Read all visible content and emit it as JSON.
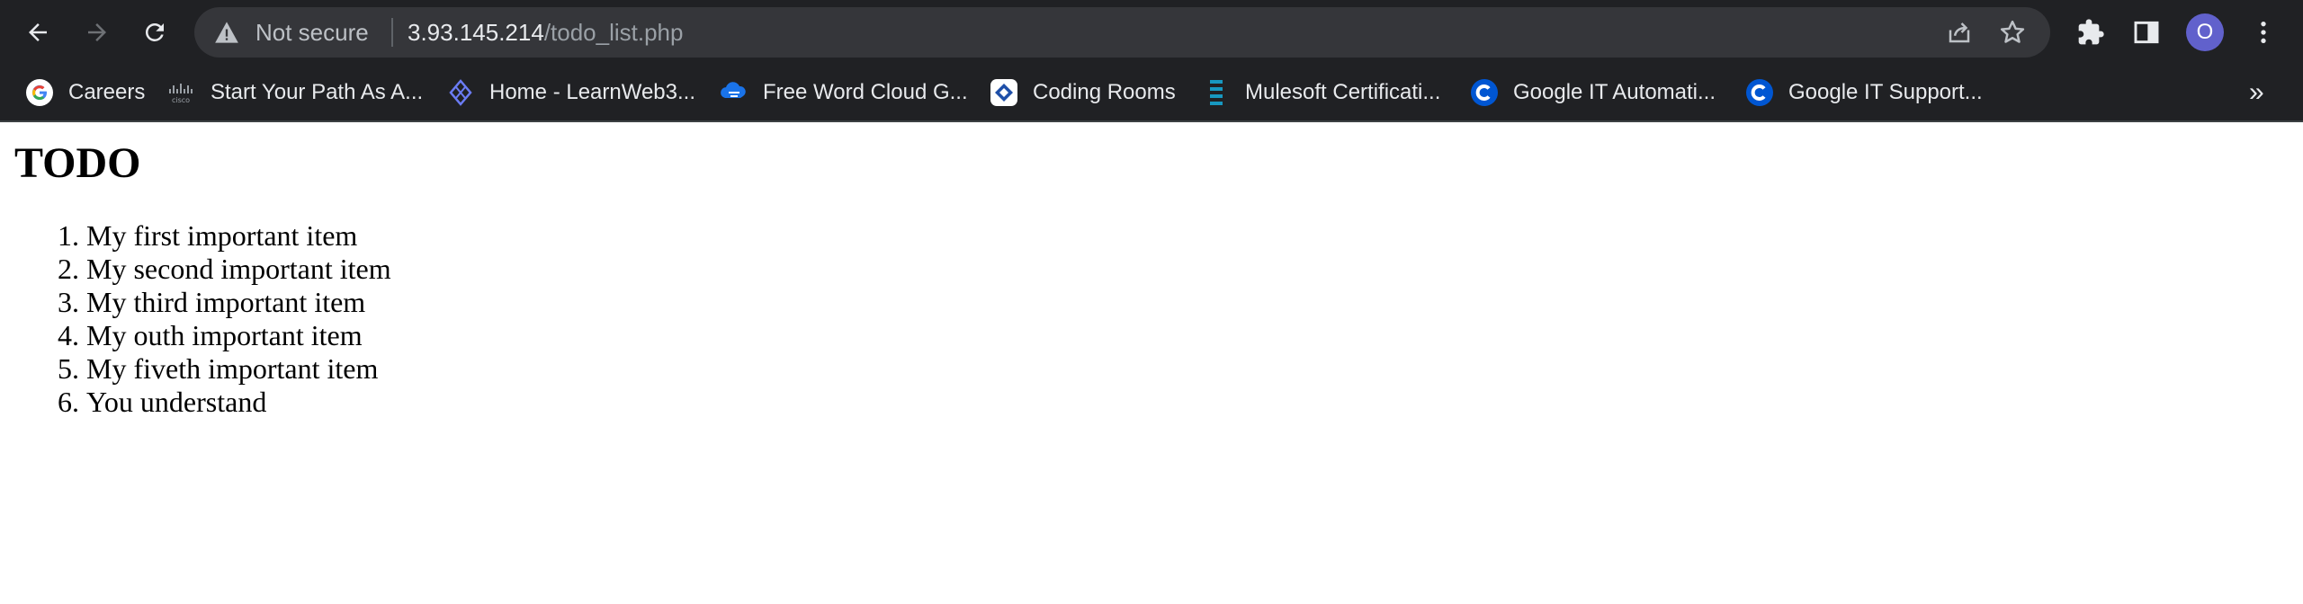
{
  "browser": {
    "security_label": "Not secure",
    "url_host": "3.93.145.214",
    "url_path": "/todo_list.php",
    "profile_initial": "O"
  },
  "bookmarks": [
    {
      "label": "Careers",
      "icon": "google-icon"
    },
    {
      "label": "Start Your Path As A...",
      "icon": "cisco-icon"
    },
    {
      "label": "Home - LearnWeb3...",
      "icon": "learnweb3-icon"
    },
    {
      "label": "Free Word Cloud G...",
      "icon": "wordcloud-icon"
    },
    {
      "label": "Coding Rooms",
      "icon": "coding-rooms-icon"
    },
    {
      "label": "Mulesoft Certificati...",
      "icon": "mulesoft-icon"
    },
    {
      "label": "Google IT Automati...",
      "icon": "coursera-icon"
    },
    {
      "label": "Google IT Support...",
      "icon": "coursera-icon"
    }
  ],
  "bookmarks_overflow": "»",
  "page": {
    "title": "TODO",
    "items": [
      "My first important item",
      "My second important item",
      "My third important item",
      "My outh important item",
      "My fiveth important item",
      "You understand"
    ]
  },
  "colors": {
    "chrome_bg": "#202124",
    "omnibox_bg": "#35363a",
    "avatar": "#6161cc",
    "coursera_blue": "#0056d2"
  }
}
